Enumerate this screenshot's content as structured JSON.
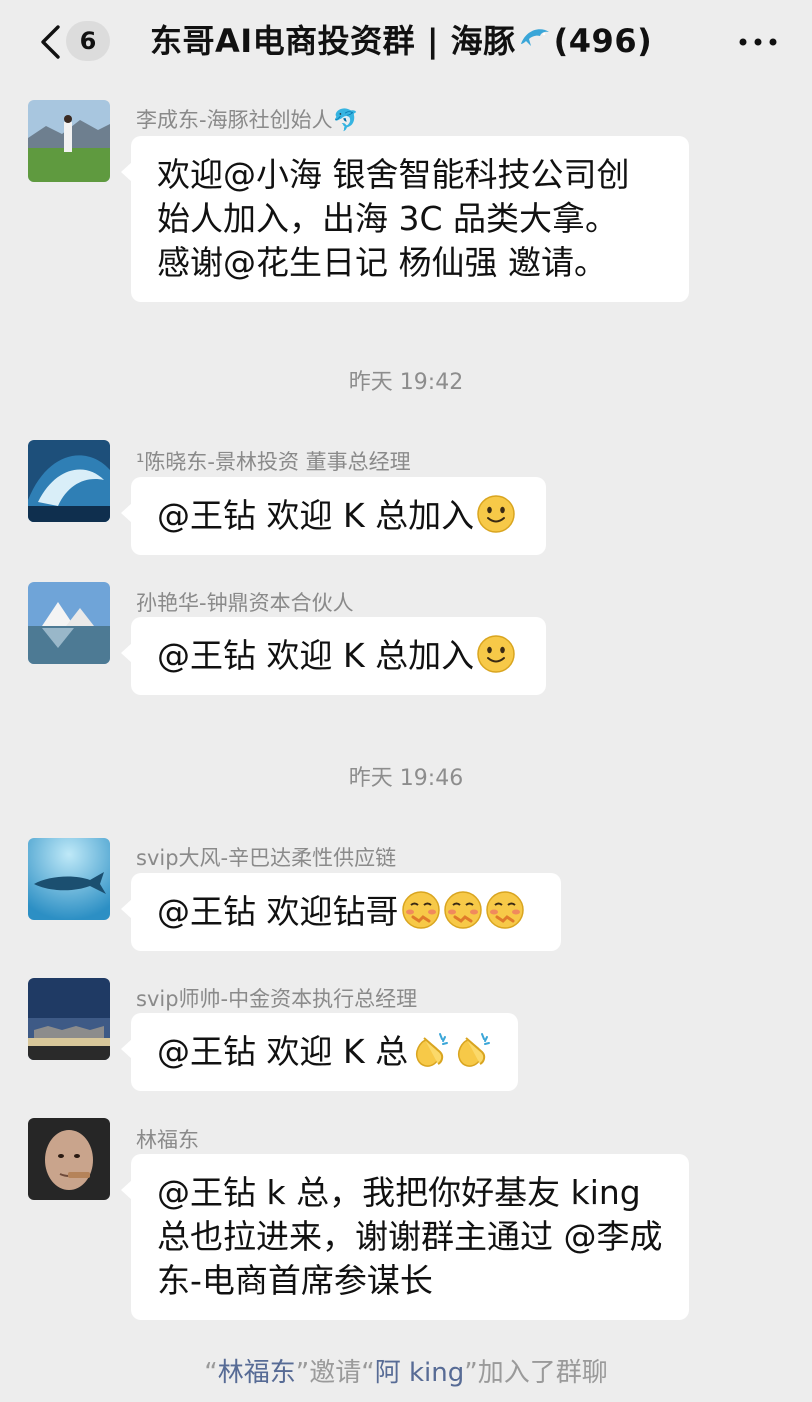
{
  "header": {
    "unread_count": "6",
    "title_part1": "东哥AI电商投资群 | 海豚",
    "title_part2": "(496)"
  },
  "messages": [
    {
      "sender": "李成东-海豚社创始人🐬",
      "lines": [
        "欢迎@小海  银舍智能科技公司创",
        "始人加入，出海 3C 品类大拿。",
        "感谢@花生日记 杨仙强  邀请。"
      ]
    },
    {
      "timestamp": "昨天 19:42"
    },
    {
      "sender": "¹陈晓东-景林投资 董事总经理",
      "lines": [
        "@王钻  欢迎 K 总加入"
      ],
      "emoji": "smile"
    },
    {
      "sender": "孙艳华-钟鼎资本合伙人",
      "lines": [
        "@王钻  欢迎 K 总加入"
      ],
      "emoji": "smile"
    },
    {
      "timestamp": "昨天 19:46"
    },
    {
      "sender": "svip大风-辛巴达柔性供应链",
      "lines": [
        "@王钻  欢迎钻哥"
      ],
      "emoji": "blush-x3"
    },
    {
      "sender": "svip师帅-中金资本执行总经理",
      "lines": [
        "@王钻  欢迎 K 总"
      ],
      "emoji": "clap-x2"
    },
    {
      "sender": "林福东",
      "lines": [
        "@王钻  k 总，我把你好基友 king",
        "总也拉进来，谢谢群主通过 @李成",
        "东-电商首席参谋长"
      ]
    }
  ],
  "system_note": {
    "inviter": "林福东",
    "action1": "邀请",
    "invitee": "阿 king",
    "action2": "加入了群聊"
  },
  "colors": {
    "background": "#ededed",
    "bubble": "#ffffff",
    "link": "#576b95",
    "meta_text": "#8a8a8a"
  }
}
